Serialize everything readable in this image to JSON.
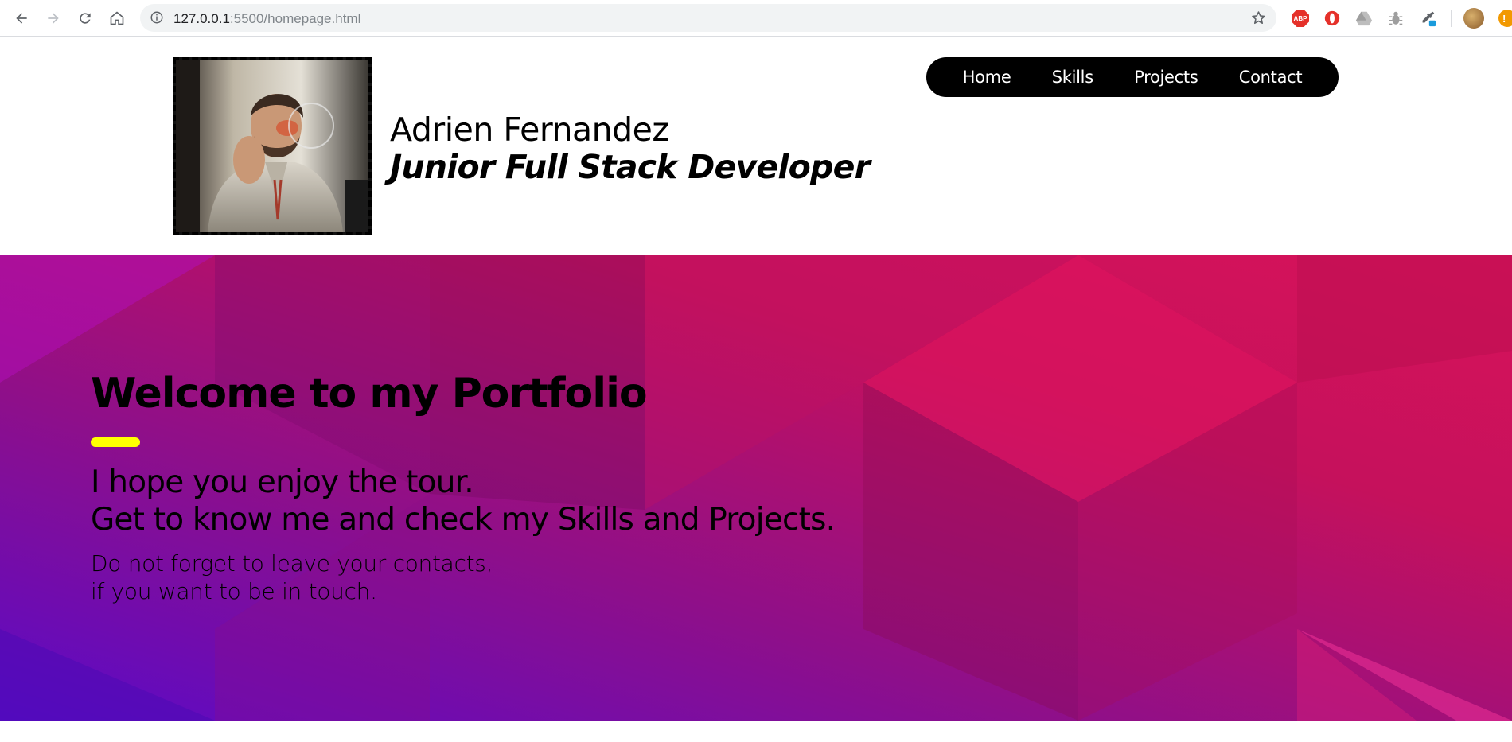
{
  "browser": {
    "url_host": "127.0.0.1",
    "url_rest": ":5500/homepage.html",
    "update_badge": "!"
  },
  "extensions": {
    "abp_label": "ABP"
  },
  "header": {
    "name": "Adrien Fernandez",
    "role": "Junior Full Stack Developer",
    "nav": [
      "Home",
      "Skills",
      "Projects",
      "Contact"
    ]
  },
  "hero": {
    "title": "Welcome to my Portfolio",
    "lead": [
      "I hope you enjoy the tour.",
      "Get to know me and check my Skills and Projects."
    ],
    "note": [
      "Do not forget to leave your contacts,",
      "if you want to be in touch."
    ],
    "accent_color": "#ffff00"
  },
  "colors": {
    "nav_bg": "#000000",
    "hero_gradient": [
      "#5a0ac8",
      "#8e0f8a",
      "#c5115c",
      "#e0135e"
    ]
  }
}
